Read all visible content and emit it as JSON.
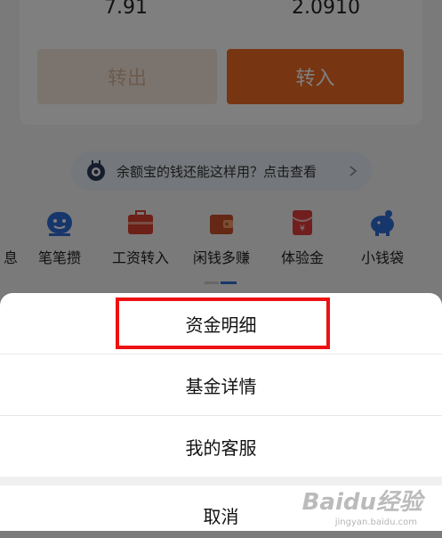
{
  "balance": {
    "left_value": "7.91",
    "right_value": "2.0910"
  },
  "actions": {
    "transfer_out": "转出",
    "transfer_in": "转入"
  },
  "promo": {
    "text": "余额宝的钱还能这样用？点击查看"
  },
  "shortcuts": [
    {
      "label": "息"
    },
    {
      "label": "笔笔攒"
    },
    {
      "label": "工资转入"
    },
    {
      "label": "闲钱多赚"
    },
    {
      "label": "体验金"
    },
    {
      "label": "小钱袋"
    }
  ],
  "sheet": {
    "items": [
      {
        "label": "资金明细"
      },
      {
        "label": "基金详情"
      },
      {
        "label": "我的客服"
      }
    ],
    "cancel": "取消"
  },
  "watermark": {
    "brand": "Baidu经验",
    "url": "jingyan.baidu.com"
  },
  "colors": {
    "accent_orange": "#ef6b25",
    "highlight_red": "#ee1111",
    "icon_blue": "#2f6cd8",
    "icon_red": "#d9402f"
  }
}
